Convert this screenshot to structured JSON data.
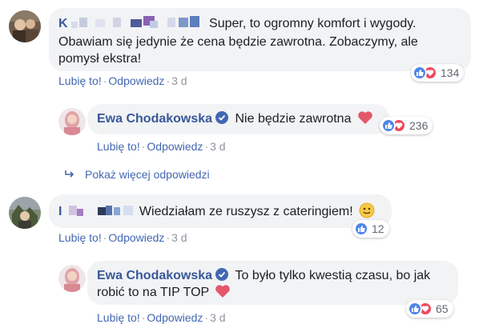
{
  "comments": [
    {
      "author_initial": "K",
      "text_line1": "Super, to ogromny komfort i wygody.",
      "text_line2": "Obawiam się jedynie że cena będzie zawrotna. Zobaczymy, ale",
      "text_line3": "pomysł ekstra!",
      "actions": {
        "like": "Lubię to!",
        "reply": "Odpowiedz",
        "time": "3 d"
      },
      "reactions": {
        "count": "134",
        "types": [
          "like",
          "love"
        ]
      }
    },
    {
      "author": "Ewa Chodakowska",
      "text": "Nie będzie zawrotna",
      "emoji": "heart-emoji",
      "actions": {
        "like": "Lubię to!",
        "reply": "Odpowiedz",
        "time": "3 d"
      },
      "reactions": {
        "count": "236",
        "types": [
          "like",
          "love"
        ]
      }
    },
    {
      "author_initial": "I",
      "text": "Wiedziałam ze ruszysz z cateringiem!",
      "emoji": "smile-emoji",
      "actions": {
        "like": "Lubię to!",
        "reply": "Odpowiedz",
        "time": "3 d"
      },
      "reactions": {
        "count": "12",
        "types": [
          "like"
        ]
      }
    },
    {
      "author": "Ewa Chodakowska",
      "text_line1": "To było tylko kwestią czasu, bo jak",
      "text_line2": "robić to na TIP TOP",
      "emoji": "heart-emoji",
      "actions": {
        "like": "Lubię to!",
        "reply": "Odpowiedz",
        "time": "3 d"
      },
      "reactions": {
        "count": "65",
        "types": [
          "like",
          "love"
        ]
      }
    }
  ],
  "show_more_replies": "Pokaż więcej odpowiedzi",
  "colors": {
    "link": "#385898",
    "action": "#4267b2",
    "bubble": "#f2f3f5",
    "like": "#4f86ea",
    "love": "#f0485d"
  }
}
